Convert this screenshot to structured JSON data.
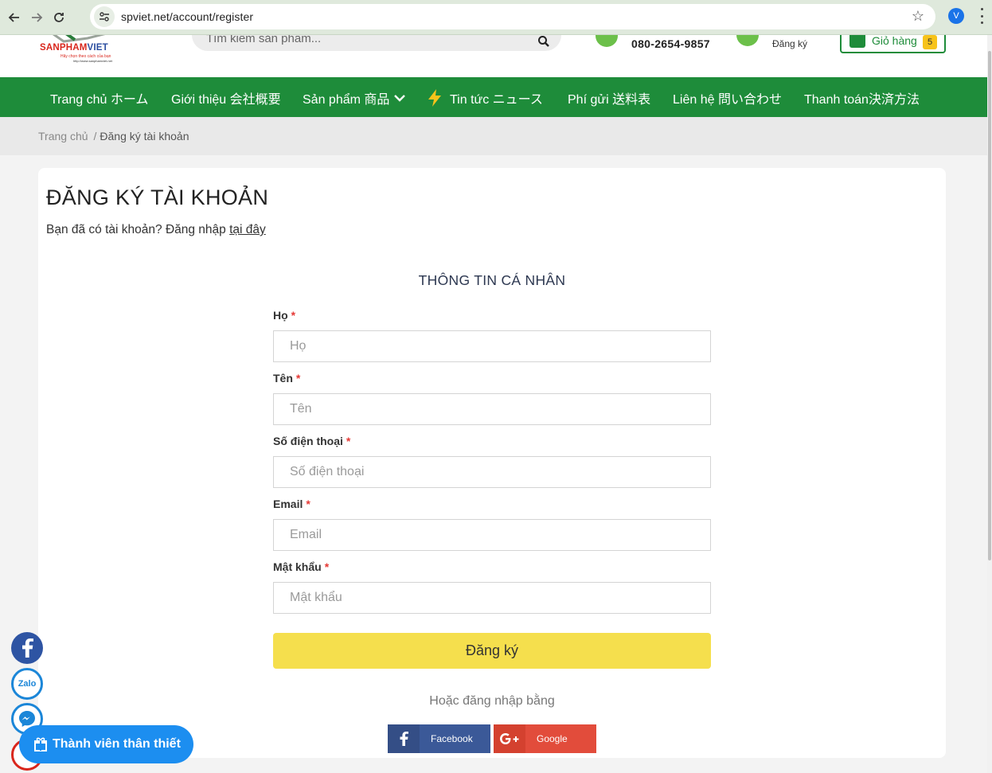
{
  "browser": {
    "url": "spviet.net/account/register"
  },
  "avatar_initial": "V",
  "header": {
    "logo_brand_part1": "SANPHAM",
    "logo_brand_part2": "VIET",
    "logo_tagline": "Hãy chọn theo cách của bạn",
    "logo_site": "http://www.sanphamviet.net",
    "search_placeholder": "Tìm kiếm sản phẩm...",
    "phone": "080-2654-9857",
    "account_label": "Đăng ký",
    "cart_label": "Giỏ hàng",
    "cart_count": "5"
  },
  "nav": {
    "home": "Trang chủ ホーム",
    "about": "Giới thiệu 会社概要",
    "products": "Sản phẩm 商品",
    "news": "Tin tức ニュース",
    "shipping": "Phí gửi 送料表",
    "contact": "Liên hệ 問い合わせ",
    "payment": "Thanh toán決済方法"
  },
  "breadcrumb": {
    "home": "Trang chủ",
    "separator": "/",
    "current": "Đăng ký tài khoản"
  },
  "page": {
    "title": "ĐĂNG KÝ TÀI KHOẢN",
    "login_prompt": "Bạn đã có tài khoản? Đăng nhập ",
    "login_link": "tại đây",
    "section_title": "THÔNG TIN CÁ NHÂN",
    "required_mark": "*"
  },
  "form": {
    "last_name": {
      "label": "Họ",
      "placeholder": "Họ",
      "value": ""
    },
    "first_name": {
      "label": "Tên",
      "placeholder": "Tên",
      "value": ""
    },
    "phone": {
      "label": "Số điện thoại",
      "placeholder": "Số điện thoại",
      "value": ""
    },
    "email": {
      "label": "Email",
      "placeholder": "Email",
      "value": ""
    },
    "password": {
      "label": "Mật khẩu",
      "placeholder": "Mật khẩu",
      "value": ""
    },
    "submit_label": "Đăng ký",
    "or_text": "Hoặc đăng nhập bằng",
    "facebook_label": "Facebook",
    "google_label": "Google"
  },
  "floating": {
    "member_label": "Thành viên thân thiết",
    "zalo_text": "Zalo"
  },
  "colors": {
    "brand_green": "#1e8c3a",
    "submit_yellow": "#f5df4d",
    "facebook_blue": "#3b5998",
    "google_red": "#e24c3b",
    "member_blue": "#1c8ef0",
    "required_red": "#e53935"
  },
  "icons": {
    "back": "arrow-left-icon",
    "forward": "arrow-right-icon",
    "reload": "reload-icon",
    "site_info": "tune-icon",
    "bookmark": "star-icon",
    "menu": "kebab-icon",
    "search": "search-icon",
    "phone": "phone-icon",
    "account": "user-icon",
    "cart": "cart-icon",
    "news": "lightning-icon",
    "dropdown": "chevron-down-icon",
    "gift": "gift-icon"
  }
}
